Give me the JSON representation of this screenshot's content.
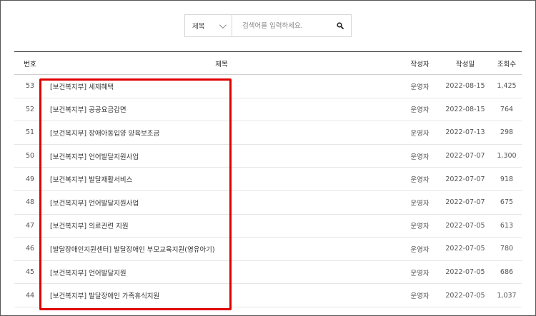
{
  "search": {
    "filter_selected": "제목",
    "placeholder": "검색어를 입력하세요.",
    "value": ""
  },
  "table": {
    "headers": {
      "no": "번호",
      "title": "제목",
      "author": "작성자",
      "date": "작성일",
      "views": "조회수"
    },
    "rows": [
      {
        "no": "53",
        "title": "[보건복지부] 세제혜택",
        "author": "운영자",
        "date": "2022-08-15",
        "views": "1,425"
      },
      {
        "no": "52",
        "title": "[보건복지부] 공공요금감면",
        "author": "운영자",
        "date": "2022-08-15",
        "views": "764"
      },
      {
        "no": "51",
        "title": "[보건복지부] 장애아동입양 양육보조금",
        "author": "운영자",
        "date": "2022-07-13",
        "views": "298"
      },
      {
        "no": "50",
        "title": "[보건복지부] 언어발달지원사업",
        "author": "운영자",
        "date": "2022-07-07",
        "views": "1,300"
      },
      {
        "no": "49",
        "title": "[보건복지부] 발달재활서비스",
        "author": "운영자",
        "date": "2022-07-07",
        "views": "918"
      },
      {
        "no": "48",
        "title": "[보건복지부] 언어발달지원사업",
        "author": "운영자",
        "date": "2022-07-07",
        "views": "675"
      },
      {
        "no": "47",
        "title": "[보건복지부] 의료관련 지원",
        "author": "운영자",
        "date": "2022-07-05",
        "views": "613"
      },
      {
        "no": "46",
        "title": "[발달장애인지원센터] 발달장애인 부모교육지원(영유아기)",
        "author": "운영자",
        "date": "2022-07-05",
        "views": "780"
      },
      {
        "no": "45",
        "title": "[보건복지부] 언어발달지원",
        "author": "운영자",
        "date": "2022-07-05",
        "views": "686"
      },
      {
        "no": "44",
        "title": "[보건복지부] 발달장애인 가족휴식지원",
        "author": "운영자",
        "date": "2022-07-05",
        "views": "1,037"
      }
    ]
  },
  "highlight_color": "#e00000"
}
